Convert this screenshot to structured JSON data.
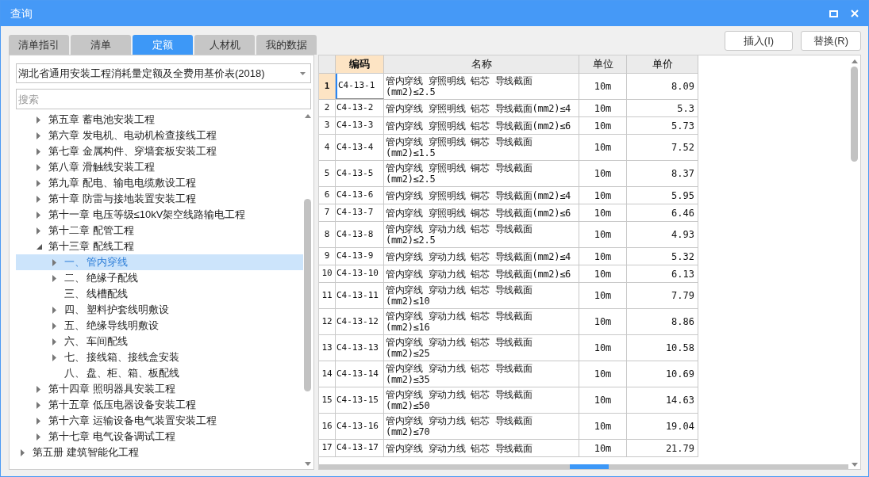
{
  "window": {
    "title": "查询"
  },
  "tabs": [
    {
      "label": "清单指引",
      "selected": false
    },
    {
      "label": "清单",
      "selected": false
    },
    {
      "label": "定额",
      "selected": true
    },
    {
      "label": "人材机",
      "selected": false
    },
    {
      "label": "我的数据",
      "selected": false
    }
  ],
  "buttons": [
    "插入(I)",
    "替换(R)"
  ],
  "library_select": {
    "value": "湖北省通用安装工程消耗量定额及全费用基价表(2018)"
  },
  "search": {
    "placeholder": "搜索"
  },
  "tree": {
    "chapters": [
      {
        "label": "第五章 蓄电池安装工程",
        "expanded": false,
        "selected": false
      },
      {
        "label": "第六章 发电机、电动机检查接线工程",
        "expanded": false,
        "selected": false
      },
      {
        "label": "第七章 金属构件、穿墙套板安装工程",
        "expanded": false,
        "selected": false
      },
      {
        "label": "第八章 滑触线安装工程",
        "expanded": false,
        "selected": false
      },
      {
        "label": "第九章 配电、输电电缆敷设工程",
        "expanded": false,
        "selected": false
      },
      {
        "label": "第十章 防雷与接地装置安装工程",
        "expanded": false,
        "selected": false
      },
      {
        "label": "第十一章 电压等级≤10kV架空线路输电工程",
        "expanded": false,
        "selected": false
      },
      {
        "label": "第十二章 配管工程",
        "expanded": false,
        "selected": false
      },
      {
        "label": "第十三章 配线工程",
        "expanded": true,
        "selected": false,
        "children": [
          {
            "number": "一、",
            "label": "管内穿线",
            "has_children": true,
            "selected": true
          },
          {
            "number": "二、",
            "label": "绝缘子配线",
            "has_children": true,
            "selected": false
          },
          {
            "number": "三、",
            "label": "线槽配线",
            "has_children": false,
            "selected": false
          },
          {
            "number": "四、",
            "label": "塑料护套线明敷设",
            "has_children": true,
            "selected": false
          },
          {
            "number": "五、",
            "label": "绝缘导线明敷设",
            "has_children": true,
            "selected": false
          },
          {
            "number": "六、",
            "label": "车间配线",
            "has_children": true,
            "selected": false
          },
          {
            "number": "七、",
            "label": "接线箱、接线盒安装",
            "has_children": true,
            "selected": false
          },
          {
            "number": "八、",
            "label": "盘、柜、箱、板配线",
            "has_children": false,
            "selected": false
          }
        ]
      },
      {
        "label": "第十四章 照明器具安装工程",
        "expanded": false,
        "selected": false
      },
      {
        "label": "第十五章 低压电器设备安装工程",
        "expanded": false,
        "selected": false
      },
      {
        "label": "第十六章 运输设备电气装置安装工程",
        "expanded": false,
        "selected": false
      },
      {
        "label": "第十七章 电气设备调试工程",
        "expanded": false,
        "selected": false
      }
    ],
    "volumes": [
      {
        "label": "第五册 建筑智能化工程",
        "expanded": false
      }
    ]
  },
  "table": {
    "columns": [
      {
        "label": "编码",
        "selected": true
      },
      {
        "label": "名称",
        "selected": false
      },
      {
        "label": "单位",
        "selected": false
      },
      {
        "label": "单价",
        "selected": false
      }
    ],
    "rows": [
      {
        "index": "1",
        "code": "C4-13-1",
        "name": "管内穿线 穿照明线 铝芯 导线截面(mm2)≤2.5",
        "unit": "10m",
        "price": "8.09",
        "selected": true
      },
      {
        "index": "2",
        "code": "C4-13-2",
        "name": "管内穿线 穿照明线 铝芯 导线截面(mm2)≤4",
        "unit": "10m",
        "price": "5.3",
        "selected": false
      },
      {
        "index": "3",
        "code": "C4-13-3",
        "name": "管内穿线 穿照明线 铝芯 导线截面(mm2)≤6",
        "unit": "10m",
        "price": "5.73",
        "selected": false
      },
      {
        "index": "4",
        "code": "C4-13-4",
        "name": "管内穿线 穿照明线 铜芯 导线截面(mm2)≤1.5",
        "unit": "10m",
        "price": "7.52",
        "selected": false
      },
      {
        "index": "5",
        "code": "C4-13-5",
        "name": "管内穿线 穿照明线 铜芯 导线截面(mm2)≤2.5",
        "unit": "10m",
        "price": "8.37",
        "selected": false
      },
      {
        "index": "6",
        "code": "C4-13-6",
        "name": "管内穿线 穿照明线 铜芯 导线截面(mm2)≤4",
        "unit": "10m",
        "price": "5.95",
        "selected": false
      },
      {
        "index": "7",
        "code": "C4-13-7",
        "name": "管内穿线 穿照明线 铜芯 导线截面(mm2)≤6",
        "unit": "10m",
        "price": "6.46",
        "selected": false
      },
      {
        "index": "8",
        "code": "C4-13-8",
        "name": "管内穿线 穿动力线 铝芯 导线截面(mm2)≤2.5",
        "unit": "10m",
        "price": "4.93",
        "selected": false
      },
      {
        "index": "9",
        "code": "C4-13-9",
        "name": "管内穿线 穿动力线 铝芯 导线截面(mm2)≤4",
        "unit": "10m",
        "price": "5.32",
        "selected": false
      },
      {
        "index": "10",
        "code": "C4-13-10",
        "name": "管内穿线 穿动力线 铝芯 导线截面(mm2)≤6",
        "unit": "10m",
        "price": "6.13",
        "selected": false
      },
      {
        "index": "11",
        "code": "C4-13-11",
        "name": "管内穿线 穿动力线 铝芯 导线截面(mm2)≤10",
        "unit": "10m",
        "price": "7.79",
        "selected": false
      },
      {
        "index": "12",
        "code": "C4-13-12",
        "name": "管内穿线 穿动力线 铝芯 导线截面(mm2)≤16",
        "unit": "10m",
        "price": "8.86",
        "selected": false
      },
      {
        "index": "13",
        "code": "C4-13-13",
        "name": "管内穿线 穿动力线 铝芯 导线截面(mm2)≤25",
        "unit": "10m",
        "price": "10.58",
        "selected": false
      },
      {
        "index": "14",
        "code": "C4-13-14",
        "name": "管内穿线 穿动力线 铝芯 导线截面(mm2)≤35",
        "unit": "10m",
        "price": "10.69",
        "selected": false
      },
      {
        "index": "15",
        "code": "C4-13-15",
        "name": "管内穿线 穿动力线 铝芯 导线截面(mm2)≤50",
        "unit": "10m",
        "price": "14.63",
        "selected": false
      },
      {
        "index": "16",
        "code": "C4-13-16",
        "name": "管内穿线 穿动力线 铝芯 导线截面(mm2)≤70",
        "unit": "10m",
        "price": "19.04",
        "selected": false
      },
      {
        "index": "17",
        "code": "C4-13-17",
        "name": "管内穿线 穿动力线 铝芯 导线截面",
        "unit": "10m",
        "price": "21.79",
        "selected": false
      }
    ]
  }
}
